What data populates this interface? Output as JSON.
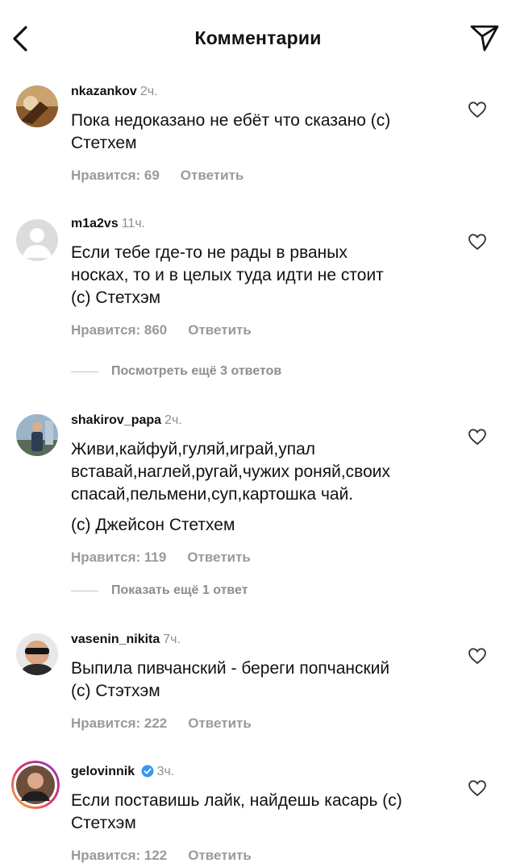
{
  "header": {
    "title": "Комментарии"
  },
  "comments": [
    {
      "username": "nkazankov",
      "time": "2ч.",
      "text": "Пока недоказано не ебёт что сказано (с)\nСтетхем",
      "likes": "Нравится: 69",
      "reply": "Ответить"
    },
    {
      "username": "m1a2vs",
      "time": "11ч.",
      "text": "Если тебе где-то не рады в рваных\nносках, то и в целых туда идти не стоит\n(с) Стетхэм",
      "likes": "Нравится: 860",
      "reply": "Ответить"
    },
    {
      "username": "shakirov_papa",
      "time": "2ч.",
      "text": "Живи,кайфуй,гуляй,играй,упал\nвставай,наглей,ругай,чужих роняй,своих\nспасай,пельмени,суп,картошка чай.",
      "text2": "(с) Джейсон Стетхем",
      "likes": "Нравится: 119",
      "reply": "Ответить"
    },
    {
      "username": "vasenin_nikita",
      "time": "7ч.",
      "text": "Выпила пивчанский - береги попчанский\n(с) Стэтхэм",
      "likes": "Нравится: 222",
      "reply": "Ответить"
    },
    {
      "username": "gelovinnik",
      "time": "3ч.",
      "text": "Если поставишь лайк, найдешь касарь (с)\nСтетхэм",
      "likes": "Нравится: 122",
      "reply": "Ответить"
    }
  ],
  "more_replies": [
    {
      "label": "Посмотреть ещё 3 ответов"
    },
    {
      "label": "Показать ещё 1 ответ"
    }
  ],
  "colors": {
    "text": "#111111",
    "meta": "#9a9a9a",
    "verified": "#3897f0"
  },
  "icons": [
    "back-arrow-icon",
    "send-icon",
    "heart-icon",
    "verified-badge-icon"
  ]
}
